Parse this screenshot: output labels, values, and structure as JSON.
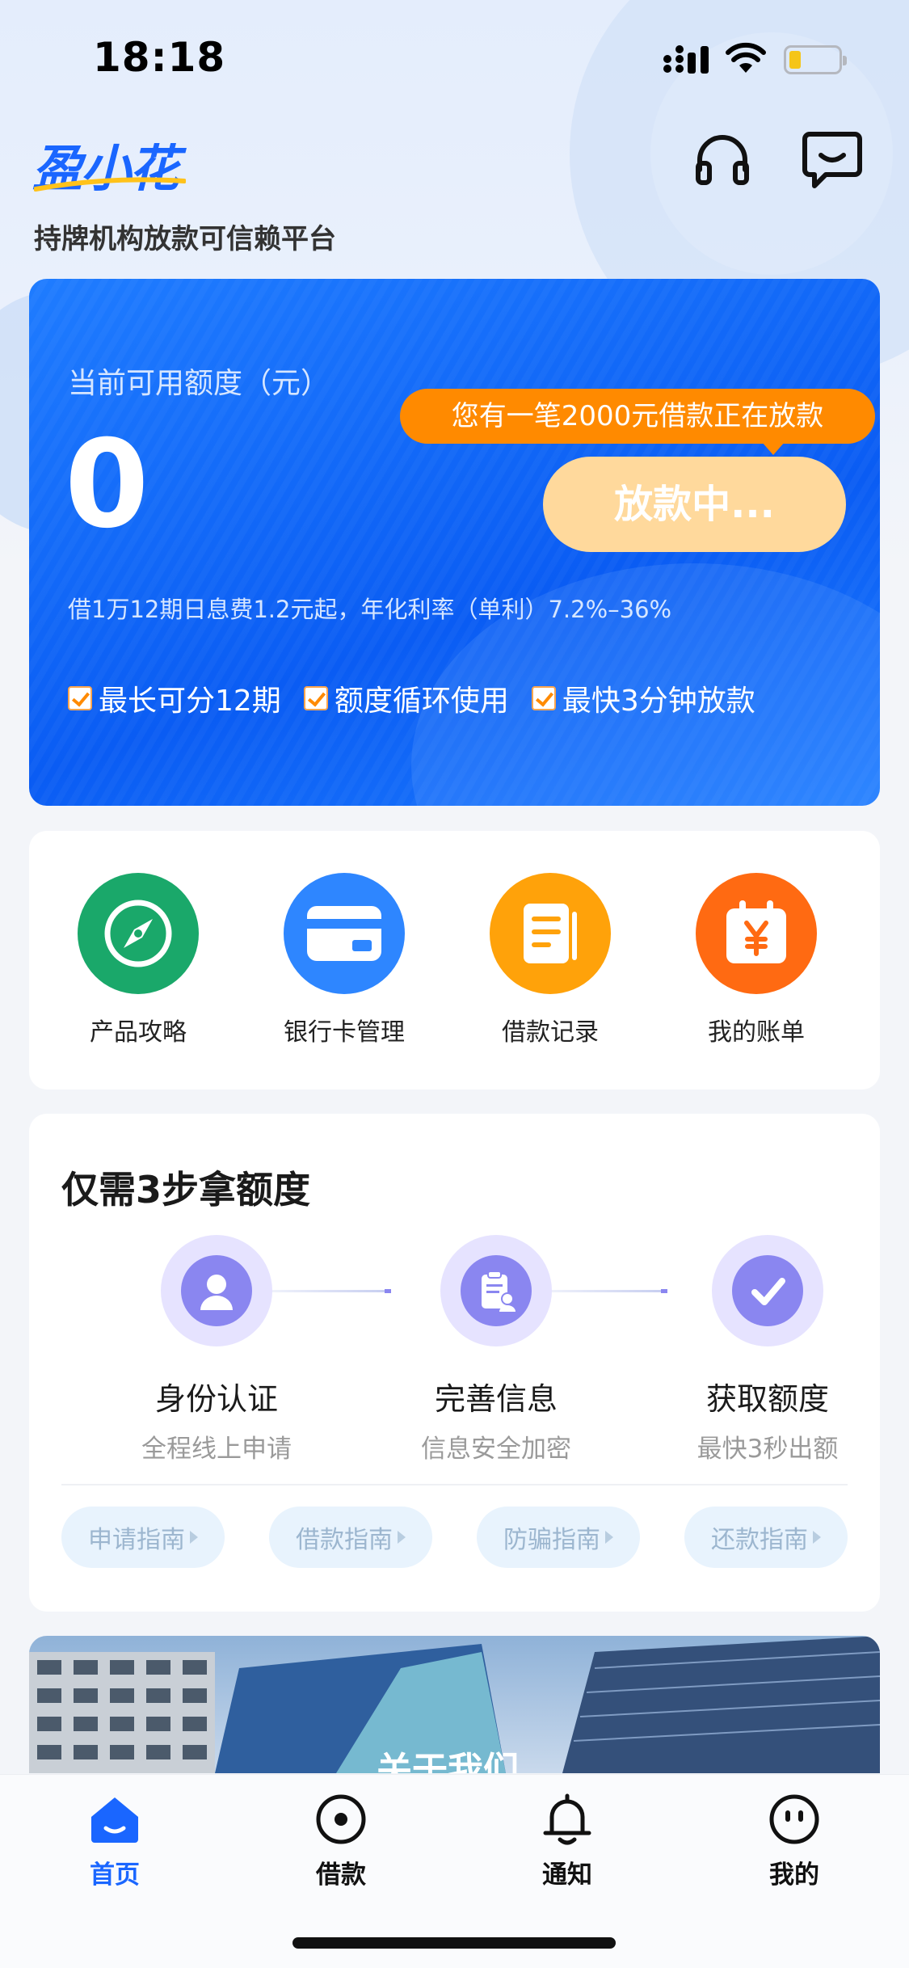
{
  "status_bar": {
    "time": "18:18"
  },
  "header": {
    "logo_text": "盈小花",
    "tagline": "持牌机构放款可信赖平台"
  },
  "credit": {
    "limit_label": "当前可用额度（元）",
    "limit_value": "0",
    "notice": "您有一笔2000元借款正在放款",
    "button_label": "放款中...",
    "rate_info": "借1万12期日息费1.2元起，年化利率（单利）7.2%–36%",
    "features": [
      "最长可分12期",
      "额度循环使用",
      "最快3分钟放款"
    ]
  },
  "quick_actions": [
    {
      "label": "产品攻略",
      "icon": "compass-icon",
      "color": "#1aa86a"
    },
    {
      "label": "银行卡管理",
      "icon": "bank-card-icon",
      "color": "#2e86ff"
    },
    {
      "label": "借款记录",
      "icon": "document-icon",
      "color": "#ffa20a"
    },
    {
      "label": "我的账单",
      "icon": "calendar-yuan-icon",
      "color": "#ff6a12"
    }
  ],
  "steps": {
    "title": "仅需3步拿额度",
    "items": [
      {
        "title": "身份认证",
        "subtitle": "全程线上申请",
        "icon": "person-icon"
      },
      {
        "title": "完善信息",
        "subtitle": "信息安全加密",
        "icon": "clipboard-icon"
      },
      {
        "title": "获取额度",
        "subtitle": "最快3秒出额",
        "icon": "checkmark-icon"
      }
    ],
    "guides": [
      "申请指南",
      "借款指南",
      "防骗指南",
      "还款指南"
    ]
  },
  "about": {
    "label": "关于我们"
  },
  "tab_bar": [
    {
      "label": "首页",
      "icon": "home-icon",
      "active": true
    },
    {
      "label": "借款",
      "icon": "loan-circle-icon",
      "active": false
    },
    {
      "label": "通知",
      "icon": "bell-icon",
      "active": false
    },
    {
      "label": "我的",
      "icon": "smiley-icon",
      "active": false
    }
  ],
  "colors": {
    "accent": "#1a66ff",
    "notice_orange": "#ff8a00",
    "button_pending": "#ffd99c",
    "step_purple": "#8a86f0"
  }
}
